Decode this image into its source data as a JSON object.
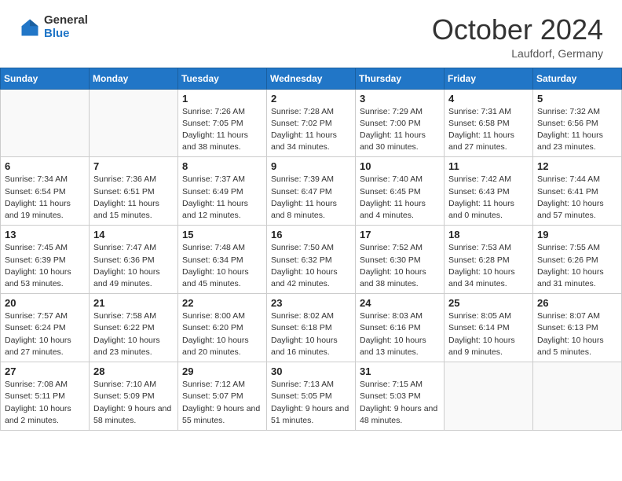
{
  "header": {
    "logo_general": "General",
    "logo_blue": "Blue",
    "month_title": "October 2024",
    "location": "Laufdorf, Germany"
  },
  "weekdays": [
    "Sunday",
    "Monday",
    "Tuesday",
    "Wednesday",
    "Thursday",
    "Friday",
    "Saturday"
  ],
  "weeks": [
    [
      {
        "day": "",
        "info": ""
      },
      {
        "day": "",
        "info": ""
      },
      {
        "day": "1",
        "info": "Sunrise: 7:26 AM\nSunset: 7:05 PM\nDaylight: 11 hours and 38 minutes."
      },
      {
        "day": "2",
        "info": "Sunrise: 7:28 AM\nSunset: 7:02 PM\nDaylight: 11 hours and 34 minutes."
      },
      {
        "day": "3",
        "info": "Sunrise: 7:29 AM\nSunset: 7:00 PM\nDaylight: 11 hours and 30 minutes."
      },
      {
        "day": "4",
        "info": "Sunrise: 7:31 AM\nSunset: 6:58 PM\nDaylight: 11 hours and 27 minutes."
      },
      {
        "day": "5",
        "info": "Sunrise: 7:32 AM\nSunset: 6:56 PM\nDaylight: 11 hours and 23 minutes."
      }
    ],
    [
      {
        "day": "6",
        "info": "Sunrise: 7:34 AM\nSunset: 6:54 PM\nDaylight: 11 hours and 19 minutes."
      },
      {
        "day": "7",
        "info": "Sunrise: 7:36 AM\nSunset: 6:51 PM\nDaylight: 11 hours and 15 minutes."
      },
      {
        "day": "8",
        "info": "Sunrise: 7:37 AM\nSunset: 6:49 PM\nDaylight: 11 hours and 12 minutes."
      },
      {
        "day": "9",
        "info": "Sunrise: 7:39 AM\nSunset: 6:47 PM\nDaylight: 11 hours and 8 minutes."
      },
      {
        "day": "10",
        "info": "Sunrise: 7:40 AM\nSunset: 6:45 PM\nDaylight: 11 hours and 4 minutes."
      },
      {
        "day": "11",
        "info": "Sunrise: 7:42 AM\nSunset: 6:43 PM\nDaylight: 11 hours and 0 minutes."
      },
      {
        "day": "12",
        "info": "Sunrise: 7:44 AM\nSunset: 6:41 PM\nDaylight: 10 hours and 57 minutes."
      }
    ],
    [
      {
        "day": "13",
        "info": "Sunrise: 7:45 AM\nSunset: 6:39 PM\nDaylight: 10 hours and 53 minutes."
      },
      {
        "day": "14",
        "info": "Sunrise: 7:47 AM\nSunset: 6:36 PM\nDaylight: 10 hours and 49 minutes."
      },
      {
        "day": "15",
        "info": "Sunrise: 7:48 AM\nSunset: 6:34 PM\nDaylight: 10 hours and 45 minutes."
      },
      {
        "day": "16",
        "info": "Sunrise: 7:50 AM\nSunset: 6:32 PM\nDaylight: 10 hours and 42 minutes."
      },
      {
        "day": "17",
        "info": "Sunrise: 7:52 AM\nSunset: 6:30 PM\nDaylight: 10 hours and 38 minutes."
      },
      {
        "day": "18",
        "info": "Sunrise: 7:53 AM\nSunset: 6:28 PM\nDaylight: 10 hours and 34 minutes."
      },
      {
        "day": "19",
        "info": "Sunrise: 7:55 AM\nSunset: 6:26 PM\nDaylight: 10 hours and 31 minutes."
      }
    ],
    [
      {
        "day": "20",
        "info": "Sunrise: 7:57 AM\nSunset: 6:24 PM\nDaylight: 10 hours and 27 minutes."
      },
      {
        "day": "21",
        "info": "Sunrise: 7:58 AM\nSunset: 6:22 PM\nDaylight: 10 hours and 23 minutes."
      },
      {
        "day": "22",
        "info": "Sunrise: 8:00 AM\nSunset: 6:20 PM\nDaylight: 10 hours and 20 minutes."
      },
      {
        "day": "23",
        "info": "Sunrise: 8:02 AM\nSunset: 6:18 PM\nDaylight: 10 hours and 16 minutes."
      },
      {
        "day": "24",
        "info": "Sunrise: 8:03 AM\nSunset: 6:16 PM\nDaylight: 10 hours and 13 minutes."
      },
      {
        "day": "25",
        "info": "Sunrise: 8:05 AM\nSunset: 6:14 PM\nDaylight: 10 hours and 9 minutes."
      },
      {
        "day": "26",
        "info": "Sunrise: 8:07 AM\nSunset: 6:13 PM\nDaylight: 10 hours and 5 minutes."
      }
    ],
    [
      {
        "day": "27",
        "info": "Sunrise: 7:08 AM\nSunset: 5:11 PM\nDaylight: 10 hours and 2 minutes."
      },
      {
        "day": "28",
        "info": "Sunrise: 7:10 AM\nSunset: 5:09 PM\nDaylight: 9 hours and 58 minutes."
      },
      {
        "day": "29",
        "info": "Sunrise: 7:12 AM\nSunset: 5:07 PM\nDaylight: 9 hours and 55 minutes."
      },
      {
        "day": "30",
        "info": "Sunrise: 7:13 AM\nSunset: 5:05 PM\nDaylight: 9 hours and 51 minutes."
      },
      {
        "day": "31",
        "info": "Sunrise: 7:15 AM\nSunset: 5:03 PM\nDaylight: 9 hours and 48 minutes."
      },
      {
        "day": "",
        "info": ""
      },
      {
        "day": "",
        "info": ""
      }
    ]
  ]
}
